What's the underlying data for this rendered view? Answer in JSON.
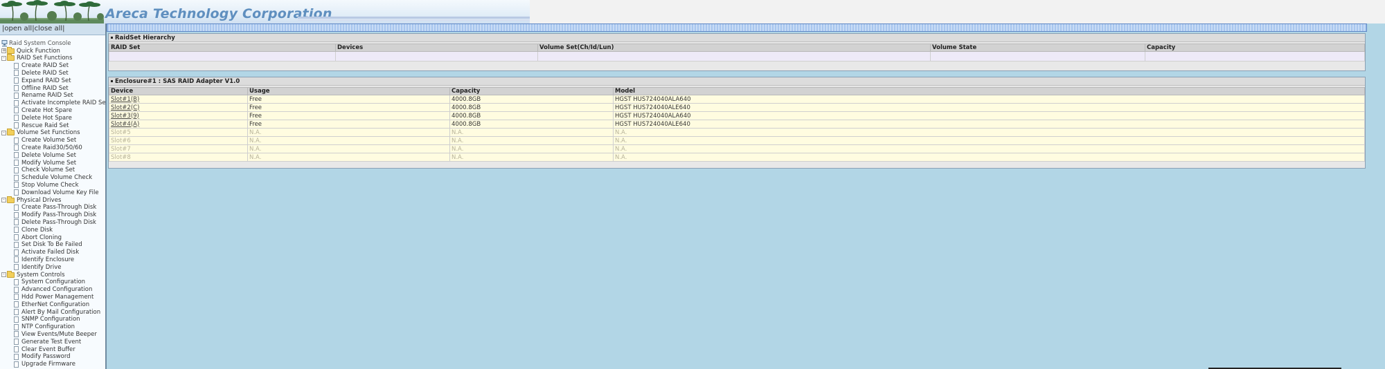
{
  "banner": {
    "title": "Areca Technology Corporation"
  },
  "sidebar": {
    "open_all": "|open all|",
    "close_all": "close all|",
    "root": "Raid System Console",
    "tree": [
      {
        "type": "folder",
        "label": "Quick Function",
        "sign": "+"
      },
      {
        "type": "folder",
        "label": "RAID Set Functions",
        "sign": "-"
      },
      {
        "type": "item",
        "label": "Create RAID Set"
      },
      {
        "type": "item",
        "label": "Delete RAID Set"
      },
      {
        "type": "item",
        "label": "Expand RAID Set"
      },
      {
        "type": "item",
        "label": "Offline RAID Set"
      },
      {
        "type": "item",
        "label": "Rename RAID Set"
      },
      {
        "type": "item",
        "label": "Activate Incomplete RAID Set"
      },
      {
        "type": "item",
        "label": "Create Hot Spare"
      },
      {
        "type": "item",
        "label": "Delete Hot Spare"
      },
      {
        "type": "item",
        "label": "Rescue Raid Set"
      },
      {
        "type": "folder",
        "label": "Volume Set Functions",
        "sign": "-"
      },
      {
        "type": "item",
        "label": "Create Volume Set"
      },
      {
        "type": "item",
        "label": "Create Raid30/50/60"
      },
      {
        "type": "item",
        "label": "Delete Volume Set"
      },
      {
        "type": "item",
        "label": "Modify Volume Set"
      },
      {
        "type": "item",
        "label": "Check Volume Set"
      },
      {
        "type": "item",
        "label": "Schedule Volume Check"
      },
      {
        "type": "item",
        "label": "Stop Volume Check"
      },
      {
        "type": "item",
        "label": "Download Volume Key File"
      },
      {
        "type": "folder",
        "label": "Physical Drives",
        "sign": "-"
      },
      {
        "type": "item",
        "label": "Create Pass-Through Disk"
      },
      {
        "type": "item",
        "label": "Modify Pass-Through Disk"
      },
      {
        "type": "item",
        "label": "Delete Pass-Through Disk"
      },
      {
        "type": "item",
        "label": "Clone Disk"
      },
      {
        "type": "item",
        "label": "Abort Cloning"
      },
      {
        "type": "item",
        "label": "Set Disk To Be Failed"
      },
      {
        "type": "item",
        "label": "Activate Failed Disk"
      },
      {
        "type": "item",
        "label": "Identify Enclosure"
      },
      {
        "type": "item",
        "label": "Identify Drive"
      },
      {
        "type": "folder",
        "label": "System Controls",
        "sign": "-"
      },
      {
        "type": "item",
        "label": "System Configuration"
      },
      {
        "type": "item",
        "label": "Advanced Configuration"
      },
      {
        "type": "item",
        "label": "Hdd Power Management"
      },
      {
        "type": "item",
        "label": "EtherNet Configuration"
      },
      {
        "type": "item",
        "label": "Alert By Mail Configuration"
      },
      {
        "type": "item",
        "label": "SNMP Configuration"
      },
      {
        "type": "item",
        "label": "NTP Configuration"
      },
      {
        "type": "item",
        "label": "View Events/Mute Beeper"
      },
      {
        "type": "item",
        "label": "Generate Test Event"
      },
      {
        "type": "item",
        "label": "Clear Event Buffer"
      },
      {
        "type": "item",
        "label": "Modify Password"
      },
      {
        "type": "item",
        "label": "Upgrade Firmware"
      }
    ]
  },
  "raidset_panel": {
    "title": "RaidSet Hierarchy",
    "columns": [
      "RAID Set",
      "Devices",
      "Volume Set(Ch/Id/Lun)",
      "Volume State",
      "Capacity"
    ]
  },
  "enclosure_panel": {
    "title": "Enclosure#1 : SAS RAID Adapter V1.0",
    "columns": [
      "Device",
      "Usage",
      "Capacity",
      "Model"
    ],
    "rows": [
      {
        "device": "Slot#1(B)",
        "usage": "Free",
        "capacity": "4000.8GB",
        "model": "HGST HUS724040ALA640",
        "present": true
      },
      {
        "device": "Slot#2(C)",
        "usage": "Free",
        "capacity": "4000.8GB",
        "model": "HGST HUS724040ALE640",
        "present": true
      },
      {
        "device": "Slot#3(9)",
        "usage": "Free",
        "capacity": "4000.8GB",
        "model": "HGST HUS724040ALA640",
        "present": true
      },
      {
        "device": "Slot#4(A)",
        "usage": "Free",
        "capacity": "4000.8GB",
        "model": "HGST HUS724040ALE640",
        "present": true
      },
      {
        "device": "Slot#5",
        "usage": "N.A.",
        "capacity": "N.A.",
        "model": "N.A.",
        "present": false
      },
      {
        "device": "Slot#6",
        "usage": "N.A.",
        "capacity": "N.A.",
        "model": "N.A.",
        "present": false
      },
      {
        "device": "Slot#7",
        "usage": "N.A.",
        "capacity": "N.A.",
        "model": "N.A.",
        "present": false
      },
      {
        "device": "Slot#8",
        "usage": "N.A.",
        "capacity": "N.A.",
        "model": "N.A.",
        "present": false
      }
    ]
  }
}
